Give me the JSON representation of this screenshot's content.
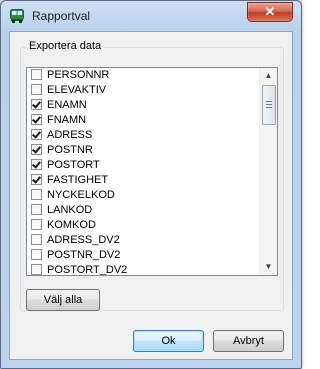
{
  "window": {
    "title": "Rapportval",
    "close_glyph": "✕"
  },
  "group": {
    "legend": "Exportera data"
  },
  "fields": [
    {
      "label": "PERSONNR",
      "checked": false
    },
    {
      "label": "ELEVAKTIV",
      "checked": false
    },
    {
      "label": "ENAMN",
      "checked": true
    },
    {
      "label": "FNAMN",
      "checked": true
    },
    {
      "label": "ADRESS",
      "checked": true
    },
    {
      "label": "POSTNR",
      "checked": true
    },
    {
      "label": "POSTORT",
      "checked": true
    },
    {
      "label": "FASTIGHET",
      "checked": true
    },
    {
      "label": "NYCKELKOD",
      "checked": false
    },
    {
      "label": "LANKOD",
      "checked": false
    },
    {
      "label": "KOMKOD",
      "checked": false
    },
    {
      "label": "ADRESS_DV2",
      "checked": false
    },
    {
      "label": "POSTNR_DV2",
      "checked": false
    },
    {
      "label": "POSTORT_DV2",
      "checked": false
    }
  ],
  "buttons": {
    "select_all": "Välj alla",
    "ok": "Ok",
    "cancel": "Avbryt"
  },
  "icons": {
    "app": "bus-icon",
    "scroll_up": "▲",
    "scroll_down": "▼"
  }
}
